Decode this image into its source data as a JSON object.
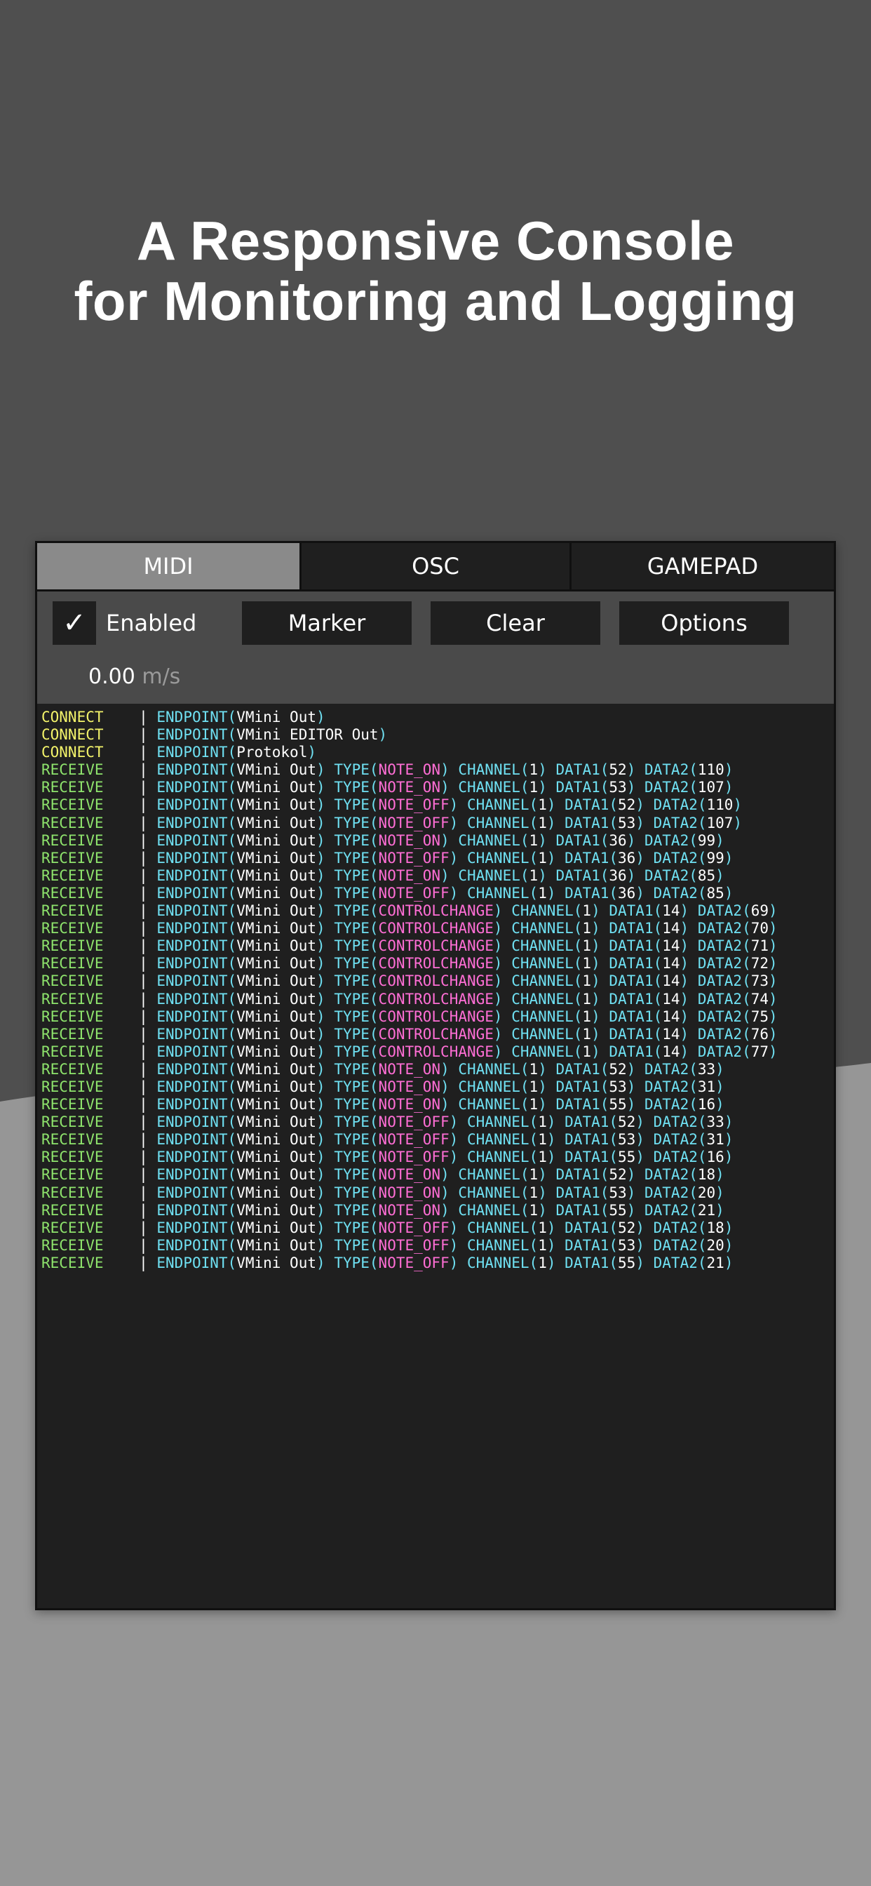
{
  "headline": {
    "line1": "A Responsive Console",
    "line2": "for Monitoring and Logging"
  },
  "colors": {
    "background_top": "#4f4f4f",
    "background_bottom": "#969696",
    "panel": "#1f1f1f",
    "toolbar": "#4a4a4a",
    "active_tab": "#8a8a8a",
    "connect": "#f3f36a",
    "receive": "#8ee36c",
    "keyword": "#6fe0f2",
    "type_value": "#ff6ed5"
  },
  "tabs": [
    {
      "label": "MIDI",
      "active": true
    },
    {
      "label": "OSC",
      "active": false
    },
    {
      "label": "GAMEPAD",
      "active": false
    }
  ],
  "toolbar": {
    "checkbox_icon": "checkmark-icon",
    "checkbox_glyph": "✓",
    "enabled_label": "Enabled",
    "marker_label": "Marker",
    "clear_label": "Clear",
    "options_label": "Options",
    "rate_value": "0.00",
    "rate_unit": "m/s"
  },
  "log": [
    {
      "event": "CONNECT",
      "endpoint": "VMini Out"
    },
    {
      "event": "CONNECT",
      "endpoint": "VMini EDITOR Out"
    },
    {
      "event": "CONNECT",
      "endpoint": "Protokol"
    },
    {
      "event": "RECEIVE",
      "endpoint": "VMini Out",
      "type": "NOTE_ON",
      "channel": "1",
      "data1": "52",
      "data2": "110"
    },
    {
      "event": "RECEIVE",
      "endpoint": "VMini Out",
      "type": "NOTE_ON",
      "channel": "1",
      "data1": "53",
      "data2": "107"
    },
    {
      "event": "RECEIVE",
      "endpoint": "VMini Out",
      "type": "NOTE_OFF",
      "channel": "1",
      "data1": "52",
      "data2": "110"
    },
    {
      "event": "RECEIVE",
      "endpoint": "VMini Out",
      "type": "NOTE_OFF",
      "channel": "1",
      "data1": "53",
      "data2": "107"
    },
    {
      "event": "RECEIVE",
      "endpoint": "VMini Out",
      "type": "NOTE_ON",
      "channel": "1",
      "data1": "36",
      "data2": "99"
    },
    {
      "event": "RECEIVE",
      "endpoint": "VMini Out",
      "type": "NOTE_OFF",
      "channel": "1",
      "data1": "36",
      "data2": "99"
    },
    {
      "event": "RECEIVE",
      "endpoint": "VMini Out",
      "type": "NOTE_ON",
      "channel": "1",
      "data1": "36",
      "data2": "85"
    },
    {
      "event": "RECEIVE",
      "endpoint": "VMini Out",
      "type": "NOTE_OFF",
      "channel": "1",
      "data1": "36",
      "data2": "85"
    },
    {
      "event": "RECEIVE",
      "endpoint": "VMini Out",
      "type": "CONTROLCHANGE",
      "channel": "1",
      "data1": "14",
      "data2": "69"
    },
    {
      "event": "RECEIVE",
      "endpoint": "VMini Out",
      "type": "CONTROLCHANGE",
      "channel": "1",
      "data1": "14",
      "data2": "70"
    },
    {
      "event": "RECEIVE",
      "endpoint": "VMini Out",
      "type": "CONTROLCHANGE",
      "channel": "1",
      "data1": "14",
      "data2": "71"
    },
    {
      "event": "RECEIVE",
      "endpoint": "VMini Out",
      "type": "CONTROLCHANGE",
      "channel": "1",
      "data1": "14",
      "data2": "72"
    },
    {
      "event": "RECEIVE",
      "endpoint": "VMini Out",
      "type": "CONTROLCHANGE",
      "channel": "1",
      "data1": "14",
      "data2": "73"
    },
    {
      "event": "RECEIVE",
      "endpoint": "VMini Out",
      "type": "CONTROLCHANGE",
      "channel": "1",
      "data1": "14",
      "data2": "74"
    },
    {
      "event": "RECEIVE",
      "endpoint": "VMini Out",
      "type": "CONTROLCHANGE",
      "channel": "1",
      "data1": "14",
      "data2": "75"
    },
    {
      "event": "RECEIVE",
      "endpoint": "VMini Out",
      "type": "CONTROLCHANGE",
      "channel": "1",
      "data1": "14",
      "data2": "76"
    },
    {
      "event": "RECEIVE",
      "endpoint": "VMini Out",
      "type": "CONTROLCHANGE",
      "channel": "1",
      "data1": "14",
      "data2": "77"
    },
    {
      "event": "RECEIVE",
      "endpoint": "VMini Out",
      "type": "NOTE_ON",
      "channel": "1",
      "data1": "52",
      "data2": "33"
    },
    {
      "event": "RECEIVE",
      "endpoint": "VMini Out",
      "type": "NOTE_ON",
      "channel": "1",
      "data1": "53",
      "data2": "31"
    },
    {
      "event": "RECEIVE",
      "endpoint": "VMini Out",
      "type": "NOTE_ON",
      "channel": "1",
      "data1": "55",
      "data2": "16"
    },
    {
      "event": "RECEIVE",
      "endpoint": "VMini Out",
      "type": "NOTE_OFF",
      "channel": "1",
      "data1": "52",
      "data2": "33"
    },
    {
      "event": "RECEIVE",
      "endpoint": "VMini Out",
      "type": "NOTE_OFF",
      "channel": "1",
      "data1": "53",
      "data2": "31"
    },
    {
      "event": "RECEIVE",
      "endpoint": "VMini Out",
      "type": "NOTE_OFF",
      "channel": "1",
      "data1": "55",
      "data2": "16"
    },
    {
      "event": "RECEIVE",
      "endpoint": "VMini Out",
      "type": "NOTE_ON",
      "channel": "1",
      "data1": "52",
      "data2": "18"
    },
    {
      "event": "RECEIVE",
      "endpoint": "VMini Out",
      "type": "NOTE_ON",
      "channel": "1",
      "data1": "53",
      "data2": "20"
    },
    {
      "event": "RECEIVE",
      "endpoint": "VMini Out",
      "type": "NOTE_ON",
      "channel": "1",
      "data1": "55",
      "data2": "21"
    },
    {
      "event": "RECEIVE",
      "endpoint": "VMini Out",
      "type": "NOTE_OFF",
      "channel": "1",
      "data1": "52",
      "data2": "18"
    },
    {
      "event": "RECEIVE",
      "endpoint": "VMini Out",
      "type": "NOTE_OFF",
      "channel": "1",
      "data1": "53",
      "data2": "20"
    },
    {
      "event": "RECEIVE",
      "endpoint": "VMini Out",
      "type": "NOTE_OFF",
      "channel": "1",
      "data1": "55",
      "data2": "21"
    }
  ]
}
